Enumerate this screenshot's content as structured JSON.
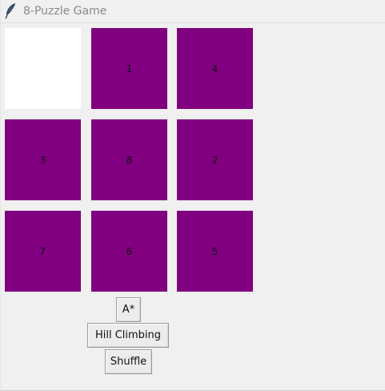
{
  "window": {
    "title": "8-Puzzle Game",
    "icon": "feather-icon"
  },
  "board": {
    "tiles": [
      "",
      "1",
      "4",
      "3",
      "8",
      "2",
      "7",
      "6",
      "5"
    ],
    "tile_color": "#800080",
    "blank_color": "#ffffff"
  },
  "buttons": {
    "astar": "A*",
    "hill_climbing": "Hill Climbing",
    "shuffle": "Shuffle"
  }
}
